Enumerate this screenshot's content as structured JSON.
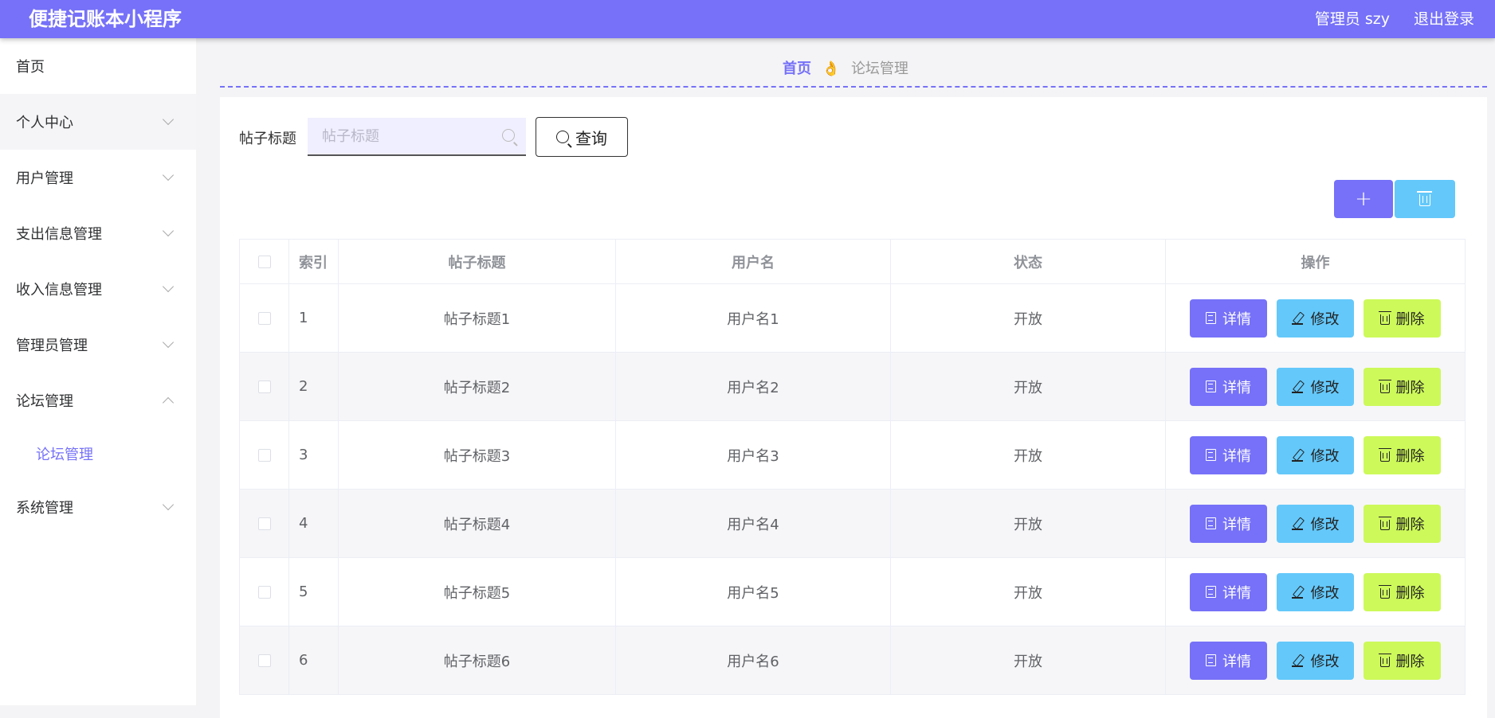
{
  "header": {
    "app_title": "便捷记账本小程序",
    "user_label": "管理员 szy",
    "logout_label": "退出登录"
  },
  "sidebar": {
    "items": [
      {
        "label": "首页",
        "has_chevron": false
      },
      {
        "label": "个人中心",
        "has_chevron": true
      },
      {
        "label": "用户管理",
        "has_chevron": true
      },
      {
        "label": "支出信息管理",
        "has_chevron": true
      },
      {
        "label": "收入信息管理",
        "has_chevron": true
      },
      {
        "label": "管理员管理",
        "has_chevron": true
      },
      {
        "label": "论坛管理",
        "has_chevron": true,
        "expanded": true,
        "subitems": [
          {
            "label": "论坛管理",
            "active": true
          }
        ]
      },
      {
        "label": "系统管理",
        "has_chevron": true
      }
    ]
  },
  "breadcrumb": {
    "home": "首页",
    "separator": "👌",
    "current": "论坛管理"
  },
  "search": {
    "label": "帖子标题",
    "placeholder": "帖子标题",
    "value": "",
    "query_label": "查询"
  },
  "toolbar": {
    "add_symbol": "+"
  },
  "table": {
    "headers": [
      "",
      "索引",
      "帖子标题",
      "用户名",
      "状态",
      "操作"
    ],
    "rows": [
      {
        "index": "1",
        "title": "帖子标题1",
        "user": "用户名1",
        "status": "开放"
      },
      {
        "index": "2",
        "title": "帖子标题2",
        "user": "用户名2",
        "status": "开放"
      },
      {
        "index": "3",
        "title": "帖子标题3",
        "user": "用户名3",
        "status": "开放"
      },
      {
        "index": "4",
        "title": "帖子标题4",
        "user": "用户名4",
        "status": "开放"
      },
      {
        "index": "5",
        "title": "帖子标题5",
        "user": "用户名5",
        "status": "开放"
      },
      {
        "index": "6",
        "title": "帖子标题6",
        "user": "用户名6",
        "status": "开放"
      }
    ],
    "actions": {
      "detail": "详情",
      "edit": "修改",
      "delete": "删除"
    }
  },
  "colors": {
    "primary": "#7671f8",
    "info": "#64c8fa",
    "danger": "#cdf95a"
  }
}
